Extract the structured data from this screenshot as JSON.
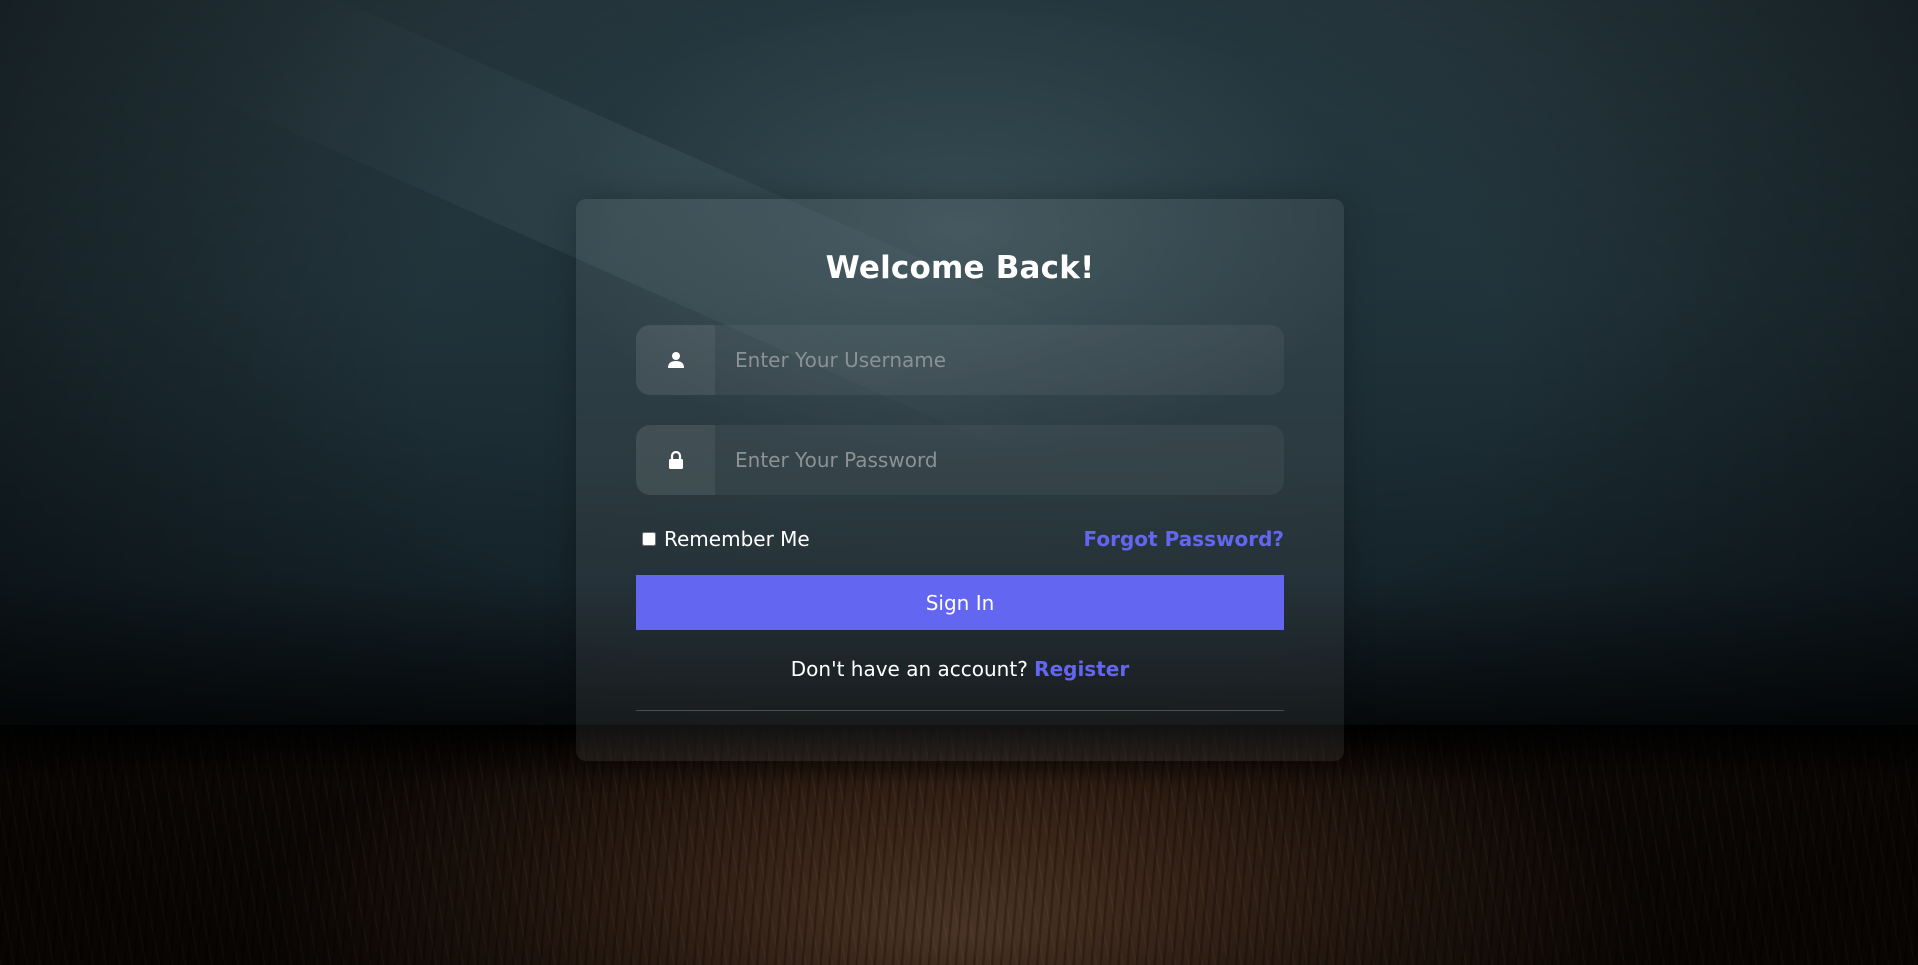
{
  "login": {
    "title": "Welcome Back!",
    "username": {
      "placeholder": "Enter Your Username",
      "value": "",
      "icon": "user-icon"
    },
    "password": {
      "placeholder": "Enter Your Password",
      "value": "",
      "icon": "lock-icon"
    },
    "remember_label": "Remember Me",
    "remember_checked": false,
    "forgot_label": "Forgot Password?",
    "signin_label": "Sign In",
    "register_prompt": "Don't have an account?",
    "register_label": "Register"
  },
  "colors": {
    "accent": "#6366f1",
    "text": "#ffffff"
  }
}
